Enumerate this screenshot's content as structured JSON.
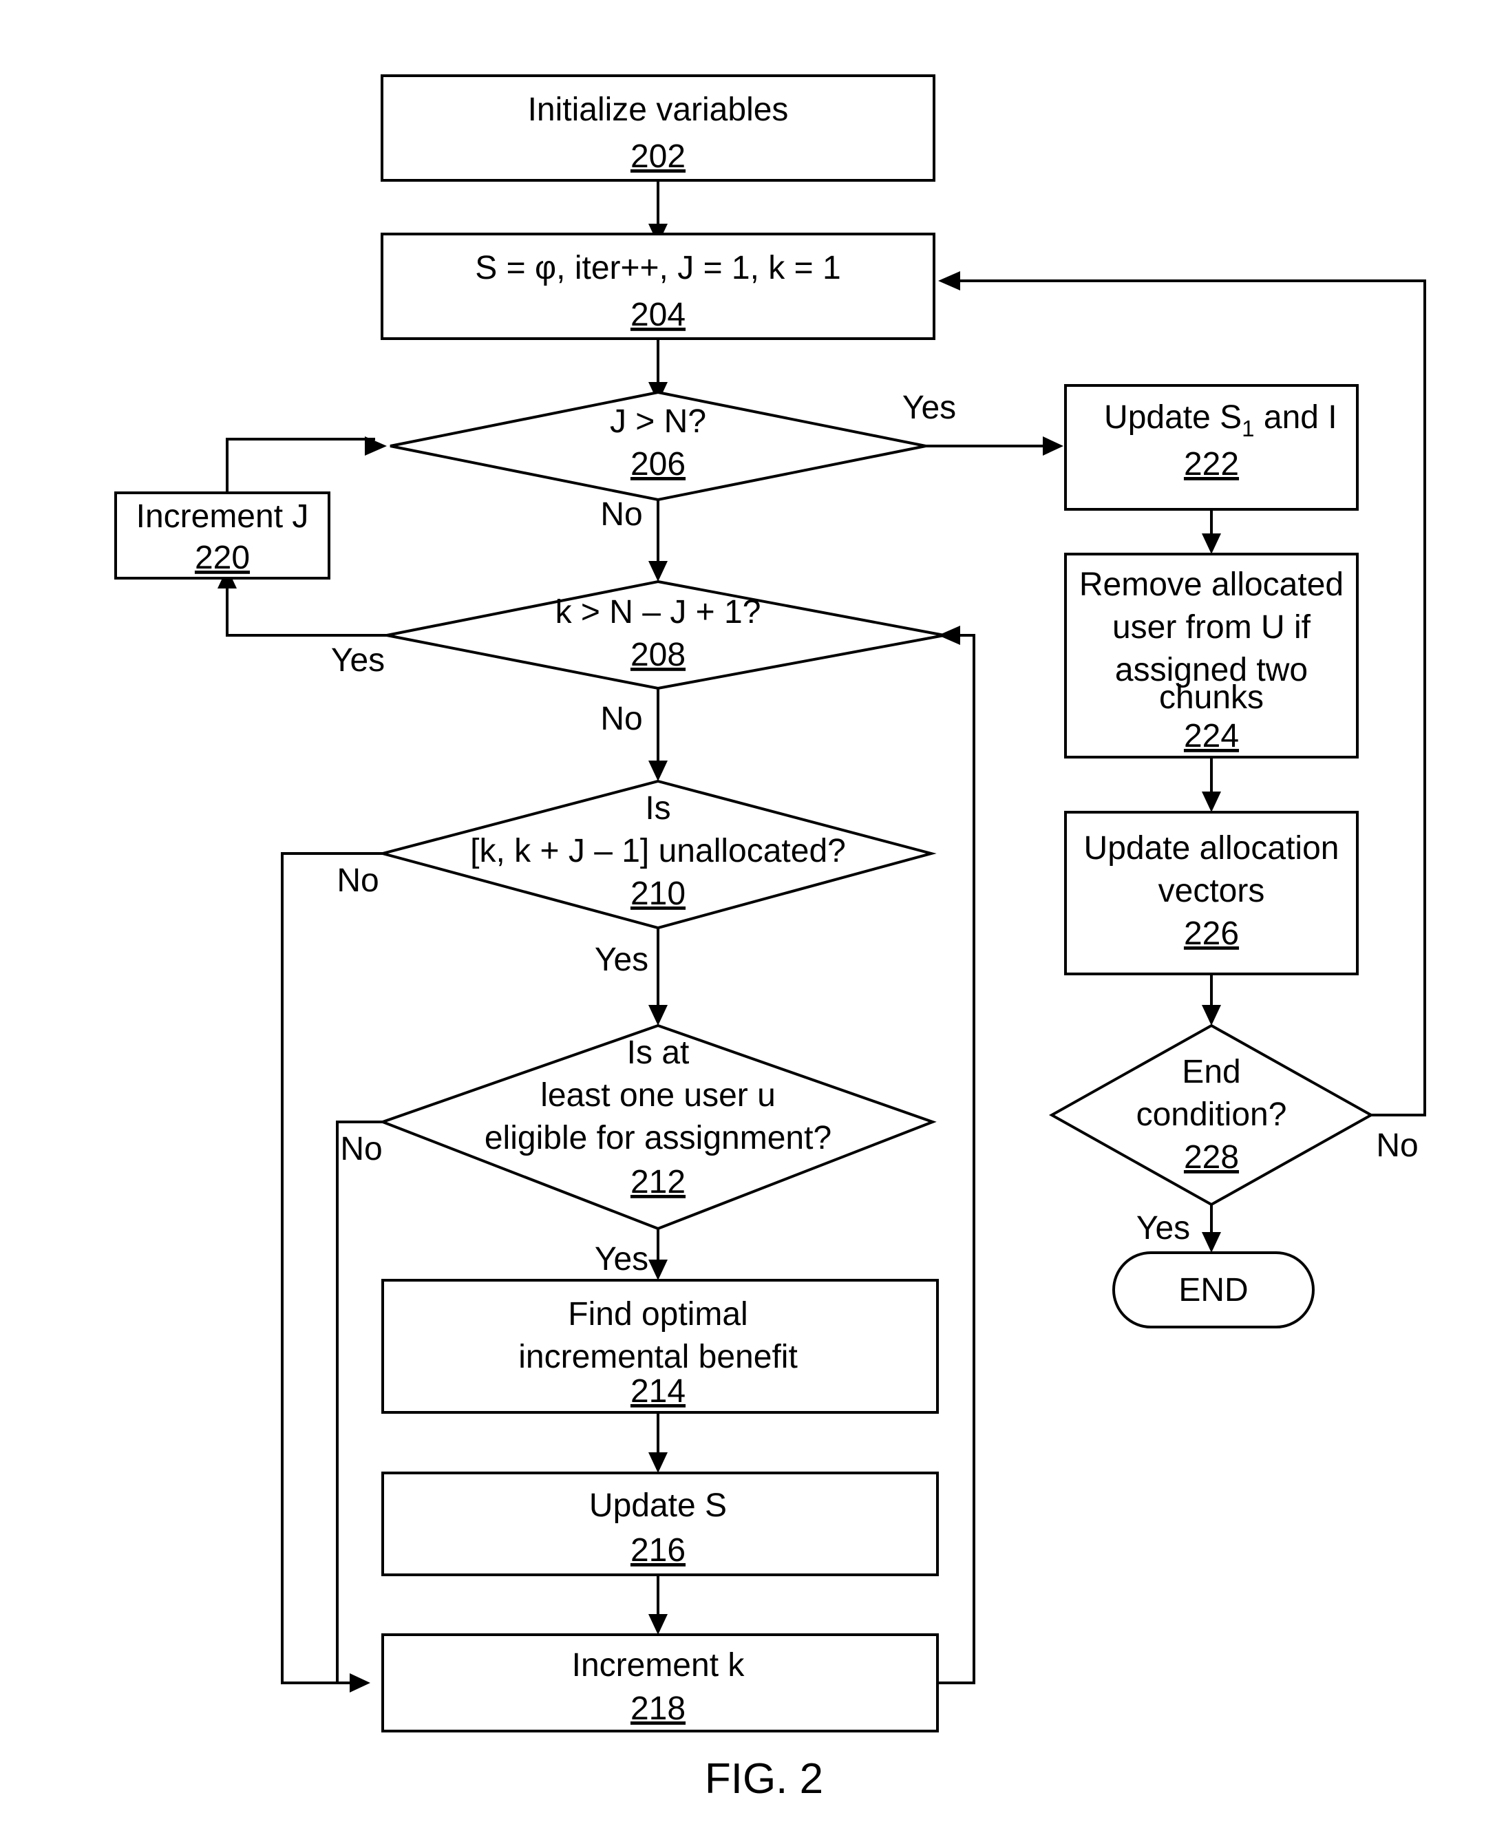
{
  "figure": {
    "caption": "FIG. 2"
  },
  "nodes": {
    "n202": {
      "lines": [
        "Initialize variables"
      ],
      "ref": "202",
      "shape": "process"
    },
    "n204": {
      "lines": [
        "S = φ, iter++, J = 1, k = 1"
      ],
      "ref": "204",
      "shape": "process"
    },
    "n206": {
      "lines": [
        "J > N?"
      ],
      "ref": "206",
      "shape": "decision"
    },
    "n208": {
      "lines": [
        "k > N – J + 1?"
      ],
      "ref": "208",
      "shape": "decision"
    },
    "n210": {
      "lines": [
        "Is",
        "[k, k + J – 1] unallocated?"
      ],
      "ref": "210",
      "shape": "decision"
    },
    "n212": {
      "lines": [
        "Is at",
        "least one user u",
        "eligible for assignment?"
      ],
      "ref": "212",
      "shape": "decision"
    },
    "n214": {
      "lines": [
        "Find optimal",
        "incremental benefit"
      ],
      "ref": "214",
      "shape": "process"
    },
    "n216": {
      "lines": [
        "Update S"
      ],
      "ref": "216",
      "shape": "process"
    },
    "n218": {
      "lines": [
        "Increment k"
      ],
      "ref": "218",
      "shape": "process"
    },
    "n220": {
      "lines": [
        "Increment J"
      ],
      "ref": "220",
      "shape": "process"
    },
    "n222": {
      "lines": [
        "Update S1 and I"
      ],
      "text_main": "Update S",
      "subscript": "1",
      "text_tail": " and I",
      "ref": "222",
      "shape": "process"
    },
    "n224": {
      "lines": [
        "Remove allocated",
        "user from U if",
        "assigned two",
        "chunks"
      ],
      "ref": "224",
      "shape": "process"
    },
    "n226": {
      "lines": [
        "Update allocation",
        "vectors"
      ],
      "ref": "226",
      "shape": "process"
    },
    "n228": {
      "lines": [
        "End",
        "condition?"
      ],
      "ref": "228",
      "shape": "decision"
    },
    "nend": {
      "lines": [
        "END"
      ],
      "ref": "",
      "shape": "terminator"
    }
  },
  "branch_labels": {
    "b206_yes": "Yes",
    "b206_no": "No",
    "b208_yes": "Yes",
    "b208_no": "No",
    "b210_no": "No",
    "b210_yes": "Yes",
    "b212_no": "No",
    "b212_yes": "Yes",
    "b228_no": "No",
    "b228_yes": "Yes"
  },
  "colors": {
    "stroke": "#000000",
    "fill": "#ffffff",
    "background": "#ffffff"
  }
}
